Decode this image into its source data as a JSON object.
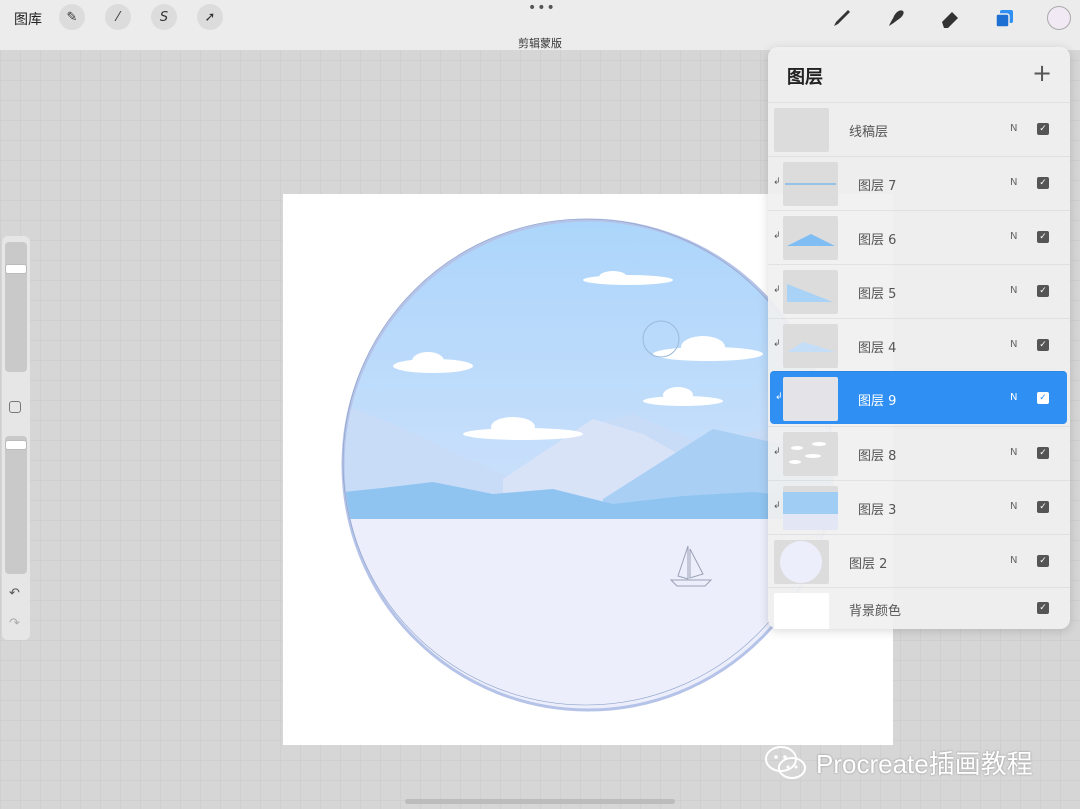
{
  "topbar": {
    "gallery_label": "图库",
    "doc_title": "剪辑蒙版",
    "more_dots": "•••",
    "tools_left": [
      {
        "icon": "wrench-icon",
        "glyph": "✎"
      },
      {
        "icon": "magic-wand-icon",
        "glyph": "⁄"
      },
      {
        "icon": "selection-icon",
        "glyph": "S"
      },
      {
        "icon": "transform-arrow-icon",
        "glyph": "➚"
      }
    ],
    "tools_right": [
      "brush-icon",
      "smudge-icon",
      "eraser-icon",
      "layers-icon"
    ],
    "active_color": "#f1e9f4",
    "accent": "#2f8ff2"
  },
  "sidebar": {
    "undo_glyph": "↶",
    "redo_glyph": "↷"
  },
  "layers_panel": {
    "title": "图层",
    "add_glyph": "+",
    "layers": [
      {
        "name": "线稿层",
        "blend": "N",
        "visible": true,
        "clipped": false,
        "active": false
      },
      {
        "name": "图层 7",
        "blend": "N",
        "visible": true,
        "clipped": true,
        "active": false
      },
      {
        "name": "图层 6",
        "blend": "N",
        "visible": true,
        "clipped": true,
        "active": false
      },
      {
        "name": "图层 5",
        "blend": "N",
        "visible": true,
        "clipped": true,
        "active": false
      },
      {
        "name": "图层 4",
        "blend": "N",
        "visible": true,
        "clipped": true,
        "active": false
      },
      {
        "name": "图层 9",
        "blend": "N",
        "visible": true,
        "clipped": true,
        "active": true
      },
      {
        "name": "图层 8",
        "blend": "N",
        "visible": true,
        "clipped": true,
        "active": false
      },
      {
        "name": "图层 3",
        "blend": "N",
        "visible": true,
        "clipped": true,
        "active": false
      },
      {
        "name": "图层 2",
        "blend": "N",
        "visible": true,
        "clipped": false,
        "active": false
      },
      {
        "name": "背景颜色",
        "blend": "",
        "visible": true,
        "clipped": false,
        "active": false
      }
    ]
  },
  "watermark": {
    "text": "Procreate插画教程",
    "icon": "wechat-icon"
  }
}
